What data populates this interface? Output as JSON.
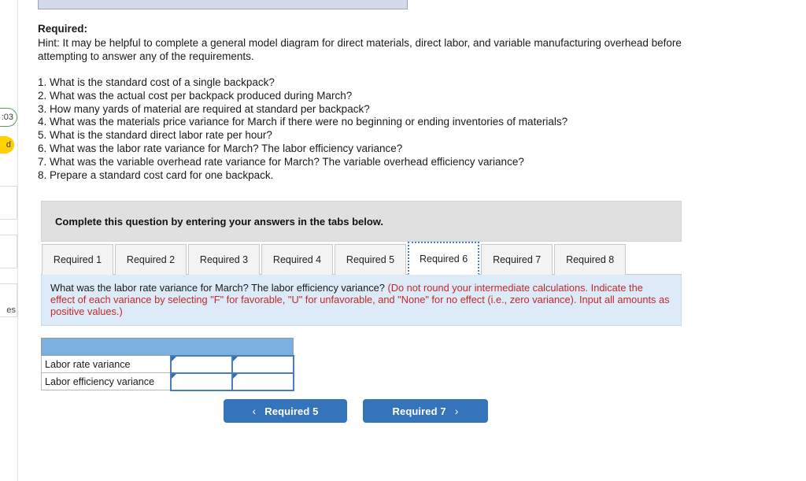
{
  "rail": {
    "timer": ":03",
    "saved_badge": "d",
    "box_label": "es"
  },
  "problem": {
    "required_heading": "Required:",
    "hint": "Hint:  It may be helpful to complete a general model diagram for direct materials, direct labor, and variable manufacturing overhead before attempting to answer any of the requirements.",
    "questions": [
      "1. What is the standard cost of a single backpack?",
      "2. What was the actual cost per backpack produced during March?",
      "3. How many yards of material are required at standard per backpack?",
      "4. What was the materials price variance for March if there were no beginning or ending inventories of materials?",
      "5. What is the standard direct labor rate per hour?",
      "6. What was the labor rate variance for March? The labor efficiency variance?",
      "7. What was the variable overhead rate variance for March? The variable overhead efficiency variance?",
      "8. Prepare a standard cost card for one backpack."
    ]
  },
  "panel": {
    "banner": "Complete this question by entering your answers in the tabs below.",
    "tabs": [
      {
        "label": "Required 1",
        "active": false
      },
      {
        "label": "Required 2",
        "active": false
      },
      {
        "label": "Required 3",
        "active": false
      },
      {
        "label": "Required 4",
        "active": false
      },
      {
        "label": "Required 5",
        "active": false
      },
      {
        "label": "Required 6",
        "active": true
      },
      {
        "label": "Required 7",
        "active": false
      },
      {
        "label": "Required 8",
        "active": false
      }
    ],
    "question_main": "What was the labor rate variance for March? The labor efficiency variance? ",
    "question_note": "(Do not round your intermediate calculations. Indicate the effect of each variance by selecting \"F\" for favorable, \"U\" for unfavorable, and \"None\" for no effect (i.e., zero variance). Input all amounts as positive values.)"
  },
  "answer_table": {
    "header_label": "",
    "rows": [
      {
        "label": "Labor rate variance",
        "amount": "",
        "effect": ""
      },
      {
        "label": "Labor efficiency variance",
        "amount": "",
        "effect": ""
      }
    ]
  },
  "nav": {
    "prev_label": "Required 5",
    "next_label": "Required 7",
    "prev_icon": "‹",
    "next_icon": "›"
  },
  "colors": {
    "accent_blue": "#3573bb",
    "table_header_blue": "#7aafe0",
    "instruction_bg": "#dcebf7",
    "note_red": "#c2282d",
    "banner_gray": "#e0e0e0",
    "badge_yellow": "#ffd100"
  }
}
